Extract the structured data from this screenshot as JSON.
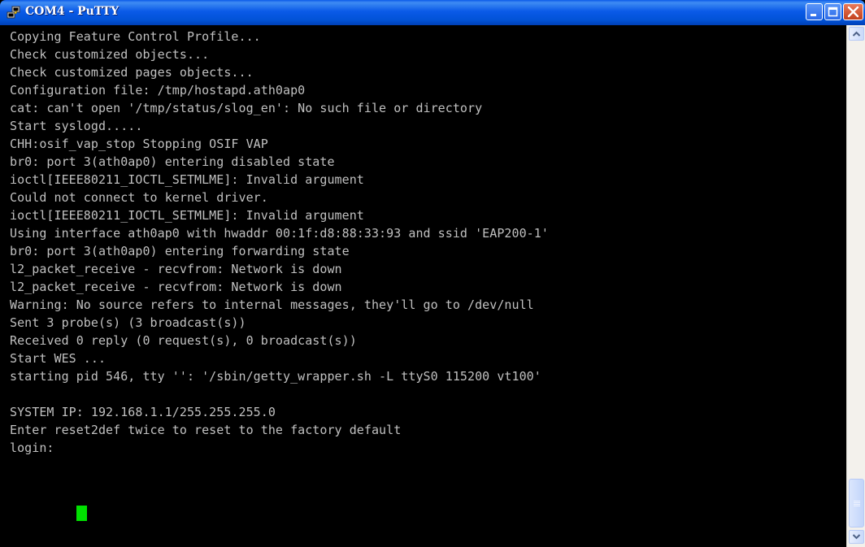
{
  "window": {
    "title": "COM4 - PuTTY"
  },
  "colors": {
    "titlebar": "#0a5ae8",
    "terminal_background": "#000000",
    "terminal_text": "#c0c0c0",
    "cursor": "#00e000",
    "close_button": "#c2401c"
  },
  "icons": {
    "app": "putty-app-icon",
    "minimize": "minimize-icon",
    "maximize": "maximize-icon",
    "close": "close-icon",
    "scroll_up": "arrow-up-icon",
    "scroll_down": "arrow-down-icon"
  },
  "terminal": {
    "lines": [
      "Copying Feature Control Profile...",
      "Check customized objects...",
      "Check customized pages objects...",
      "Configuration file: /tmp/hostapd.ath0ap0",
      "cat: can't open '/tmp/status/slog_en': No such file or directory",
      "Start syslogd.....",
      "CHH:osif_vap_stop Stopping OSIF VAP",
      "br0: port 3(ath0ap0) entering disabled state",
      "ioctl[IEEE80211_IOCTL_SETMLME]: Invalid argument",
      "Could not connect to kernel driver.",
      "ioctl[IEEE80211_IOCTL_SETMLME]: Invalid argument",
      "Using interface ath0ap0 with hwaddr 00:1f:d8:88:33:93 and ssid 'EAP200-1'",
      "br0: port 3(ath0ap0) entering forwarding state",
      "l2_packet_receive - recvfrom: Network is down",
      "l2_packet_receive - recvfrom: Network is down",
      "Warning: No source refers to internal messages, they'll go to /dev/null",
      "Sent 3 probe(s) (3 broadcast(s))",
      "Received 0 reply (0 request(s), 0 broadcast(s))",
      "Start WES ...",
      "starting pid 546, tty '': '/sbin/getty_wrapper.sh -L ttyS0 115200 vt100'",
      "",
      "SYSTEM IP: 192.168.1.1/255.255.255.0",
      "Enter reset2def twice to reset to the factory default",
      "login: "
    ]
  }
}
